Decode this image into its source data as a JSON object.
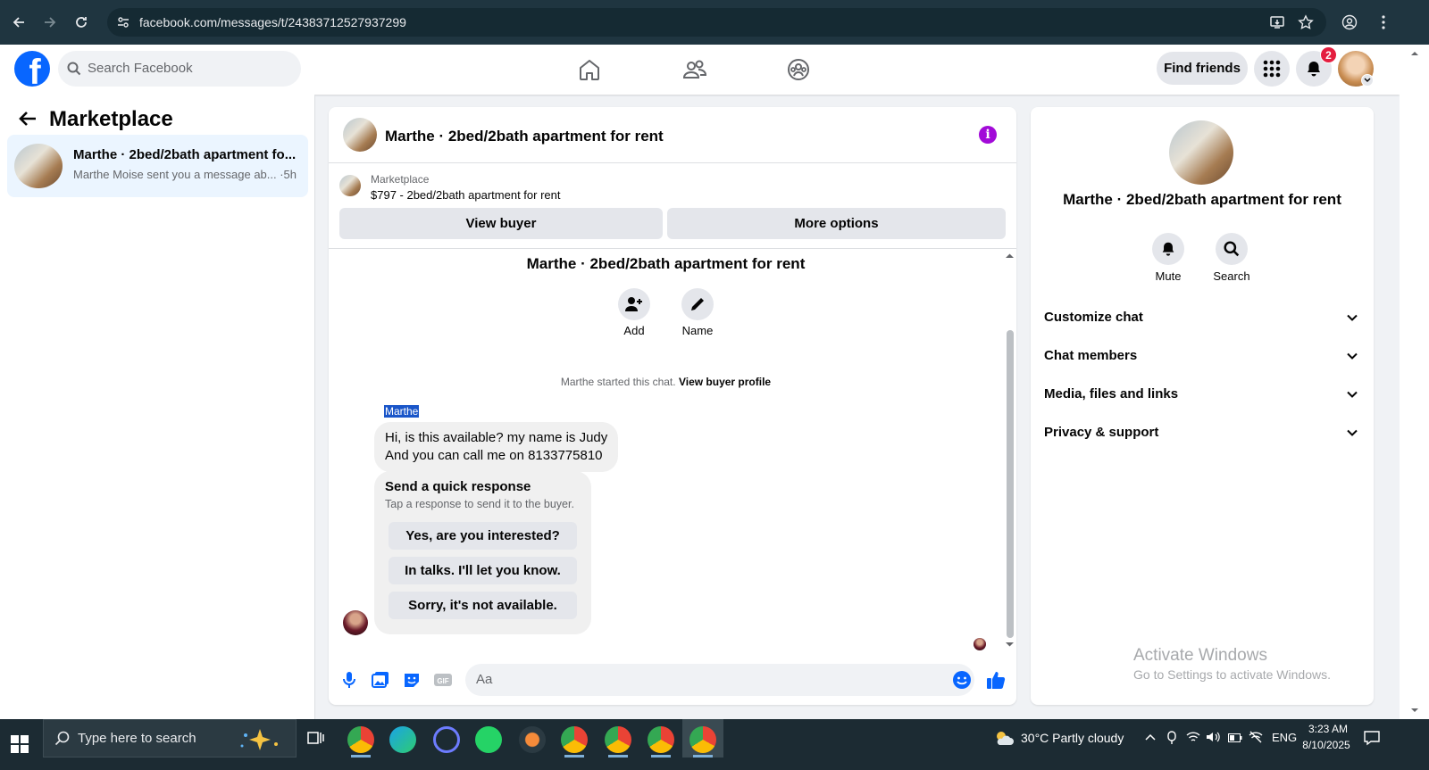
{
  "browser": {
    "url": "facebook.com/messages/t/24383712527937299"
  },
  "header": {
    "logo": "f",
    "search_placeholder": "Search Facebook",
    "find_friends": "Find friends",
    "notification_count": "2"
  },
  "left": {
    "title": "Marketplace",
    "conversations": [
      {
        "title": "Marthe · 2bed/2bath apartment fo...",
        "subtitle": "Marthe Moise sent you a message ab... ·5h"
      }
    ]
  },
  "chat": {
    "title": "Marthe · 2bed/2bath apartment for rent",
    "marketplace_label": "Marketplace",
    "listing": "$797 - 2bed/2bath apartment for rent",
    "view_buyer": "View buyer",
    "more_options": "More options",
    "thread_title": "Marthe · 2bed/2bath apartment for rent",
    "add_label": "Add",
    "name_label": "Name",
    "started_text": "Marthe started this chat.",
    "view_buyer_profile": "View buyer profile",
    "sender": "Marthe",
    "message_line1": "Hi, is this available? my name is Judy",
    "message_line2": "And you can call me on 8133775810",
    "quick_title": "Send a quick response",
    "quick_sub": "Tap a response to send it to the buyer.",
    "quick_responses": [
      "Yes, are you interested?",
      "In talks. I'll let you know.",
      "Sorry, it's not available."
    ],
    "composer_placeholder": "Aa",
    "gif_label": "GIF"
  },
  "right": {
    "title": "Marthe · 2bed/2bath apartment for rent",
    "mute": "Mute",
    "search": "Search",
    "rows": [
      "Customize chat",
      "Chat members",
      "Media, files and links",
      "Privacy & support"
    ]
  },
  "watermark": {
    "line1": "Activate Windows",
    "line2": "Go to Settings to activate Windows."
  },
  "taskbar": {
    "search": "Type here to search",
    "weather": "30°C  Partly cloudy",
    "lang": "ENG",
    "time": "3:23 AM",
    "date": "8/10/2025"
  },
  "colors": {
    "facebook_blue": "#0866ff",
    "messenger_purple": "#a20ad8",
    "badge_red": "#e41e3f",
    "selected_item": "#ebf5ff"
  }
}
